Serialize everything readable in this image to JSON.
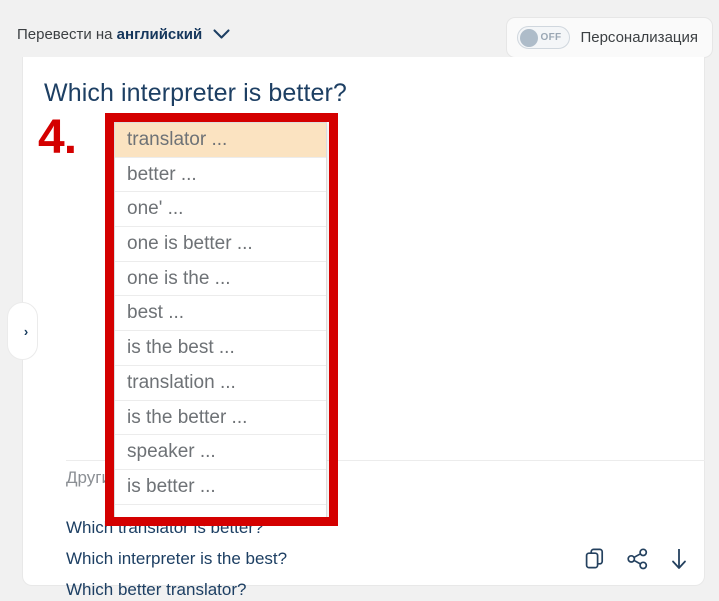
{
  "topbar": {
    "translate_prefix": "Перевести на ",
    "translate_language": "английский",
    "chevron_icon": "chevron-down-icon",
    "toggle_state": "OFF",
    "personalization_label": "Персонализация"
  },
  "side_tab": {
    "glyph": "›",
    "icon": "chevron-right-icon"
  },
  "main": {
    "question": "Which interpreter is better?",
    "others_label": "Другие",
    "alternatives": [
      "Which translator is better?",
      "Which interpreter is the best?",
      "Which better translator?"
    ]
  },
  "dropdown": {
    "items": [
      {
        "label": "translator ...",
        "selected": true
      },
      {
        "label": "better ...",
        "selected": false
      },
      {
        "label": "one' ...",
        "selected": false
      },
      {
        "label": "one is better ...",
        "selected": false
      },
      {
        "label": "one is the ...",
        "selected": false
      },
      {
        "label": "best ...",
        "selected": false
      },
      {
        "label": "is the best ...",
        "selected": false
      },
      {
        "label": "translation ...",
        "selected": false
      },
      {
        "label": "is the better ...",
        "selected": false
      },
      {
        "label": "speaker ...",
        "selected": false
      },
      {
        "label": "is better ...",
        "selected": false
      }
    ]
  },
  "annotation": {
    "number": "4.",
    "color": "#d40000"
  },
  "actions": [
    {
      "name": "copy-icon",
      "label": "Copy"
    },
    {
      "name": "share-icon",
      "label": "Share"
    },
    {
      "name": "download-icon",
      "label": "Download"
    }
  ],
  "colors": {
    "accent": "#14365c",
    "highlight": "#fbe3c1",
    "annotation": "#d40000",
    "page_bg": "#f1f1f1"
  }
}
